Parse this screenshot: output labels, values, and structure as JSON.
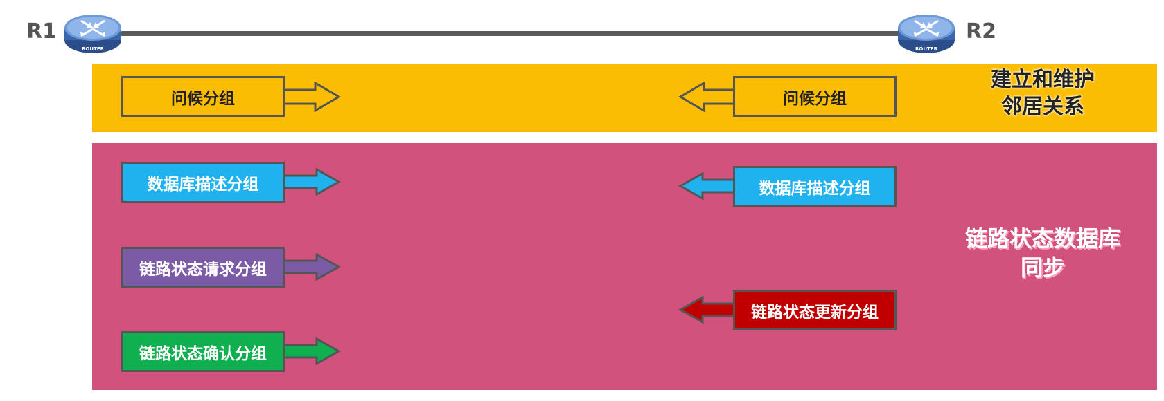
{
  "routers": {
    "left": {
      "label": "R1",
      "icon": "router-icon",
      "caption": "ROUTER"
    },
    "right": {
      "label": "R2",
      "icon": "router-icon",
      "caption": "ROUTER"
    }
  },
  "phases": {
    "neighbor": {
      "title_line1": "建立和维护",
      "title_line2": "邻居关系",
      "color": "#fbbd04"
    },
    "sync": {
      "title_line1": "链路状态数据库",
      "title_line2": "同步",
      "color": "#d1527c"
    }
  },
  "packets": {
    "hello_r1": {
      "label": "问候分组",
      "color": "#fbbd04",
      "direction": "right"
    },
    "hello_r2": {
      "label": "问候分组",
      "color": "#fbbd04",
      "direction": "left"
    },
    "dbd_r1": {
      "label": "数据库描述分组",
      "color": "#1fb2ee",
      "direction": "right"
    },
    "dbd_r2": {
      "label": "数据库描述分组",
      "color": "#1fb2ee",
      "direction": "left"
    },
    "lsr_r1": {
      "label": "链路状态请求分组",
      "color": "#7b5aa6",
      "direction": "right"
    },
    "lsu_r2": {
      "label": "链路状态更新分组",
      "color": "#c00000",
      "direction": "left"
    },
    "lsack_r1": {
      "label": "链路状态确认分组",
      "color": "#10b050",
      "direction": "right"
    }
  }
}
